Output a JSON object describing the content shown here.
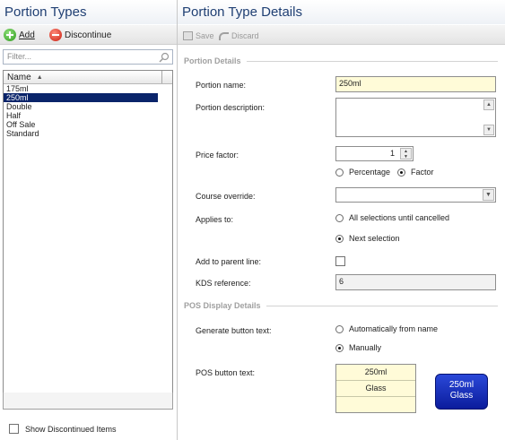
{
  "left": {
    "title": "Portion Types",
    "toolbar": {
      "add_label": "Add",
      "discontinue_label": "Discontinue"
    },
    "filter_placeholder": "Filter...",
    "list": {
      "column_header": "Name",
      "items": [
        "175ml",
        "250ml",
        "Double",
        "Half",
        "Off Sale",
        "Standard"
      ],
      "selected": "250ml"
    },
    "show_discontinued_label": "Show Discontinued Items"
  },
  "right": {
    "title": "Portion Type Details",
    "toolbar": {
      "save_label": "Save",
      "discard_label": "Discard"
    },
    "portion_details": {
      "section_title": "Portion Details",
      "name_label": "Portion name:",
      "name_value": "250ml",
      "description_label": "Portion description:",
      "description_value": "",
      "price_factor_label": "Price factor:",
      "price_factor_value": "1",
      "percentage_label": "Percentage",
      "factor_label": "Factor",
      "course_override_label": "Course override:",
      "course_override_value": "",
      "applies_to_label": "Applies to:",
      "applies_all_label": "All selections until cancelled",
      "applies_next_label": "Next selection",
      "add_to_parent_label": "Add to parent line:",
      "kds_reference_label": "KDS reference:",
      "kds_reference_value": "6"
    },
    "pos_display": {
      "section_title": "POS Display Details",
      "generate_label": "Generate button text:",
      "auto_label": "Automatically from name",
      "manual_label": "Manually",
      "button_text_label": "POS button text:",
      "button_text_lines": [
        "250ml",
        "Glass",
        ""
      ],
      "preview_line1": "250ml",
      "preview_line2": "Glass"
    }
  },
  "colors": {
    "title_text": "#1f3f73",
    "selection": "#0a246a",
    "preview_button": "#1a34c4",
    "field_yellow": "#fffbd8"
  }
}
